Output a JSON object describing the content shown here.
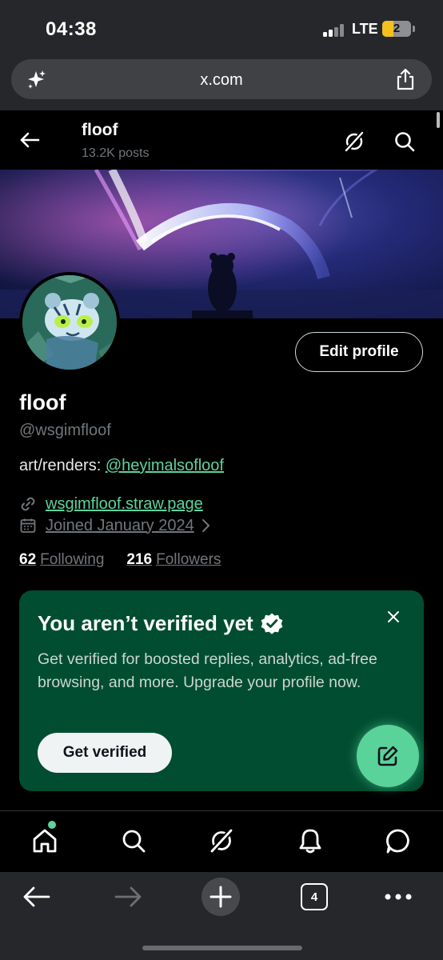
{
  "status_bar": {
    "time": "04:38",
    "network": "LTE",
    "battery_level": "2"
  },
  "browser": {
    "url": "x.com",
    "left_icon": "sparkle-icon",
    "share_icon": "share-icon"
  },
  "header": {
    "name": "floof",
    "posts": "13.2K posts"
  },
  "profile": {
    "edit_label": "Edit profile",
    "display_name": "floof",
    "handle": "@wsgimfloof",
    "bio_prefix": "art/renders: ",
    "bio_mention": "@heyimalsofloof",
    "website": "wsgimfloof.straw.page",
    "joined": "Joined January 2024",
    "following_count": "62",
    "following_label": "Following",
    "followers_count": "216",
    "followers_label": "Followers"
  },
  "verify_card": {
    "title": "You aren’t verified yet",
    "body": "Get verified for boosted replies, analytics, ad-free browsing, and more. Upgrade your profile now.",
    "button": "Get verified"
  },
  "bottom_nav": {
    "items": [
      "home-icon",
      "search-icon",
      "grok-icon",
      "notifications-icon",
      "messages-icon"
    ]
  },
  "safari_toolbar": {
    "tab_count": "4"
  },
  "colors": {
    "accent": "#5dd39e",
    "card_bg": "#004d31",
    "fab": "#59d39a",
    "background": "#000000"
  }
}
